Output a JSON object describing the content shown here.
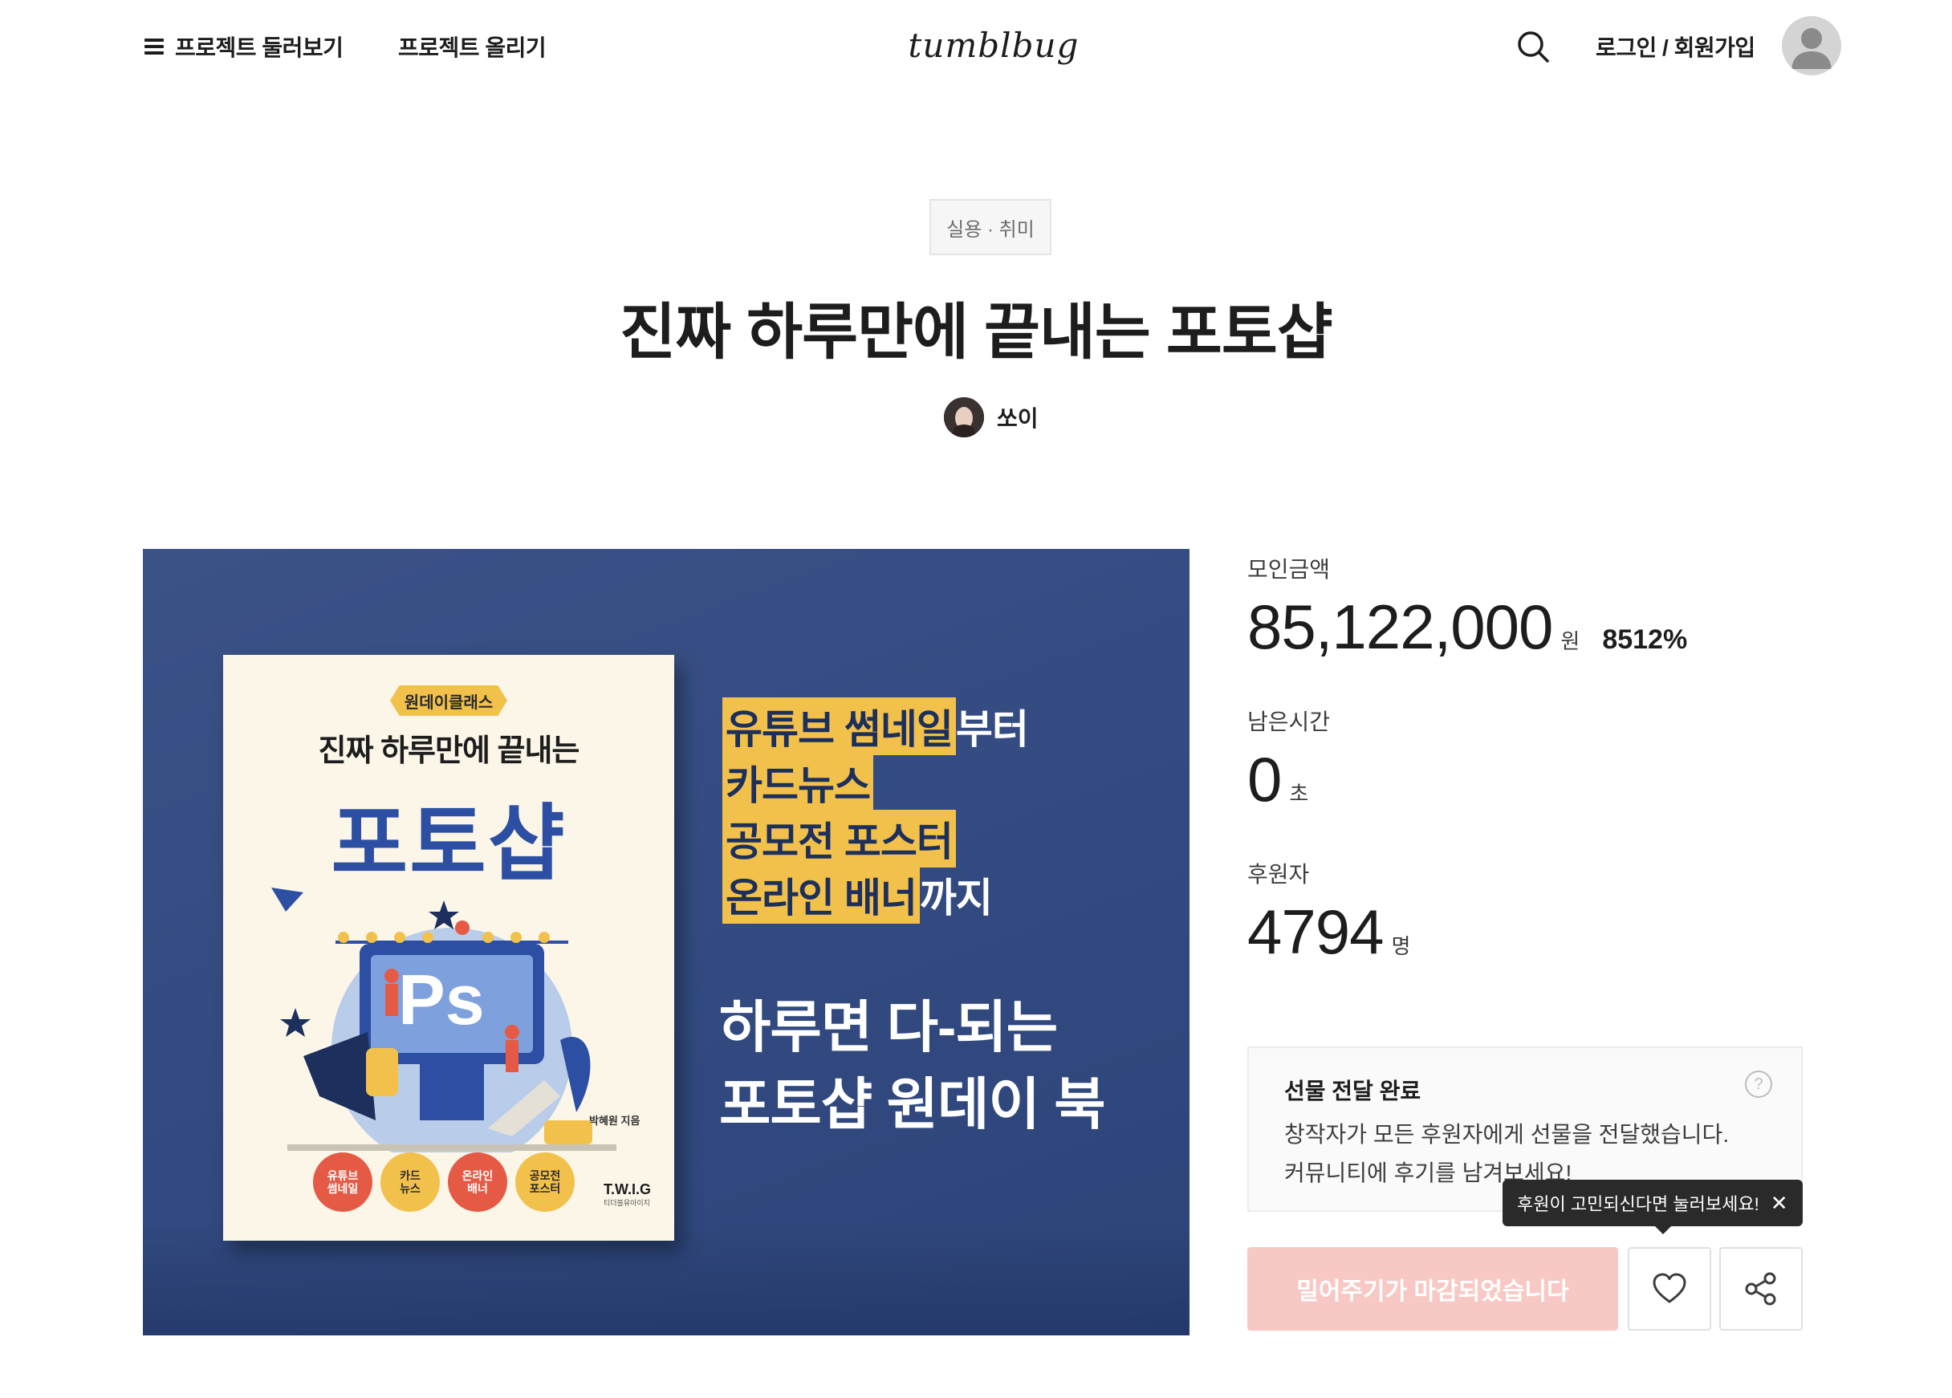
{
  "header": {
    "menu_label": "프로젝트 둘러보기",
    "upload_label": "프로젝트 올리기",
    "logo_text": "tumblbug",
    "login_label": "로그인 / 회원가입"
  },
  "project": {
    "category": "실용 · 취미",
    "title": "진짜 하루만에 끝내는 포토샵",
    "creator": "쏘이"
  },
  "hero_image": {
    "book": {
      "badge": "원데이클래스",
      "subtitle": "진짜 하루만에 끝내는",
      "title": "포토샵",
      "author": "박혜원 지음",
      "tags": [
        "유튜브\n썸네일",
        "카드\n뉴스",
        "온라인\n배너",
        "공모전\n포스터"
      ],
      "publisher": "T.W.I.G",
      "publisher_sub": "티더블유아이지",
      "app_label": "Ps"
    },
    "lines": [
      {
        "highlight": "유튜브 썸네일",
        "rest": " 부터"
      },
      {
        "highlight": "카드뉴스",
        "rest": ""
      },
      {
        "highlight": "공모전 포스터",
        "rest": ""
      },
      {
        "highlight": "온라인 배너",
        "rest": " 까지"
      }
    ],
    "tagline_1": "하루면 다-되는",
    "tagline_2": "포토샵 원데이 북"
  },
  "stats": {
    "raised_label": "모인금액",
    "raised_value": "85,122,000",
    "raised_unit": "원",
    "raised_percent": "8512%",
    "time_label": "남은시간",
    "time_value": "0",
    "time_unit": "초",
    "backers_label": "후원자",
    "backers_value": "4794",
    "backers_unit": "명"
  },
  "status_box": {
    "title": "선물 전달 완료",
    "desc_1": "창작자가 모든 후원자에게 선물을 전달했습니다.",
    "desc_2": "커뮤니티에 후기를 남겨보세요!",
    "help": "?"
  },
  "tooltip": {
    "text": "후원이 고민되신다면 눌러보세요!",
    "close": "✕"
  },
  "actions": {
    "support_label": "밀어주기가 마감되었습니다"
  },
  "colors": {
    "support_disabled": "#f8c8c4",
    "hero_bg": "#3b5287",
    "highlight": "#f2c14b",
    "book_title": "#2c4fa3"
  },
  "icons": [
    "menu-icon",
    "search-icon",
    "user-avatar-icon",
    "help-icon",
    "close-icon",
    "heart-icon",
    "share-icon"
  ]
}
